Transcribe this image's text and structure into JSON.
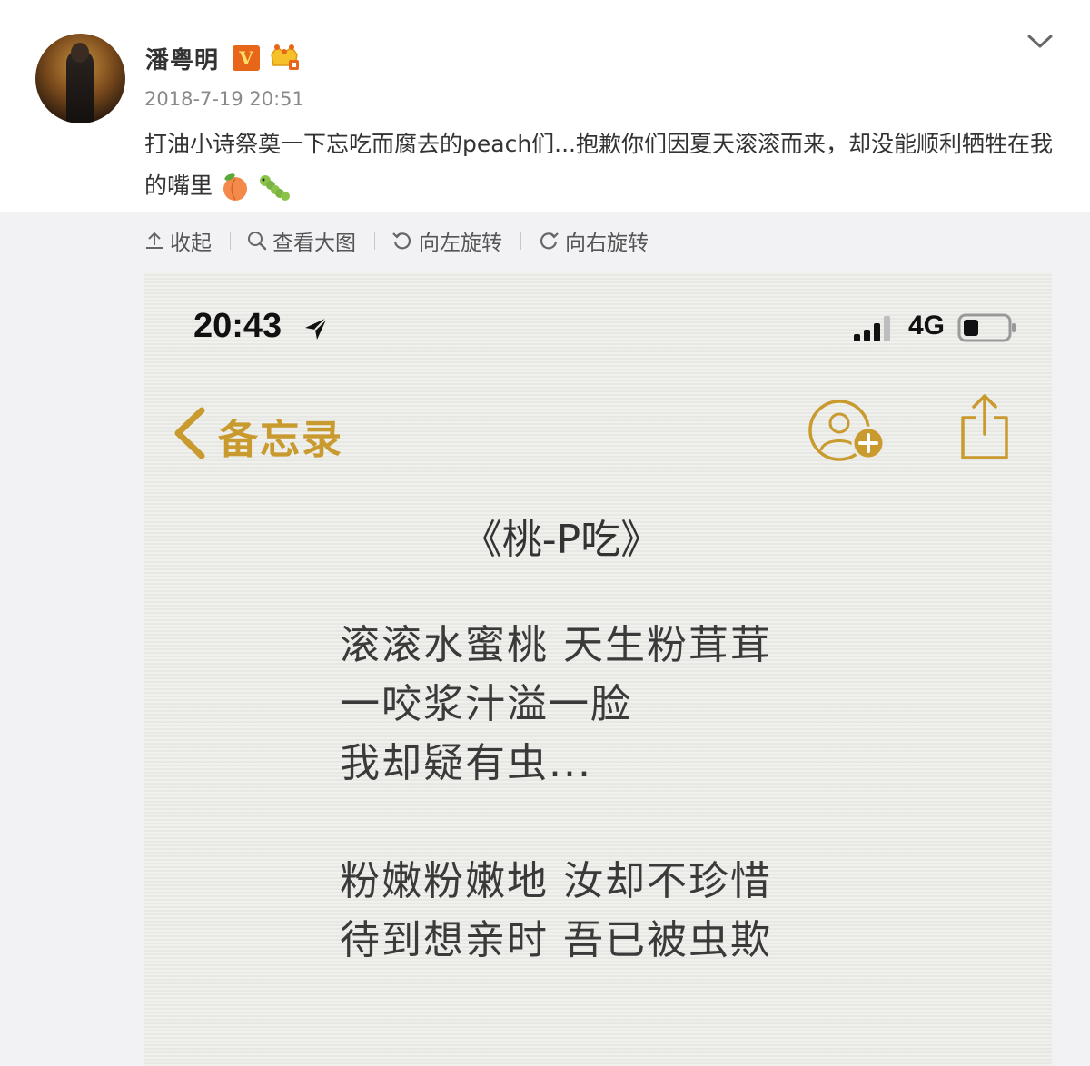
{
  "post": {
    "username": "潘粤明",
    "verified_label": "V",
    "timestamp": "2018-7-19 20:51",
    "text": "打油小诗祭奠一下忘吃而腐去的peach们...抱歉你们因夏天滚滚而来，却没能顺利牺牲在我的嘴里",
    "emojis": [
      "peach-emoji",
      "caterpillar-emoji"
    ]
  },
  "toolbar": {
    "collapse": "收起",
    "view_large": "查看大图",
    "rotate_left": "向左旋转",
    "rotate_right": "向右旋转"
  },
  "phone": {
    "time": "20:43",
    "network": "4G",
    "back_label": "备忘录"
  },
  "note": {
    "title": "《桃-P吃》",
    "lines": [
      "滚滚水蜜桃 天生粉茸茸",
      "一咬浆汁溢一脸",
      "我却疑有虫...",
      "粉嫩粉嫩地 汝却不珍惜",
      "待到想亲时 吾已被虫欺"
    ]
  },
  "colors": {
    "accent_gold": "#c99a2e",
    "text_main": "#333333",
    "timestamp": "#8a8a8a",
    "verified_orange": "#e8661a"
  }
}
